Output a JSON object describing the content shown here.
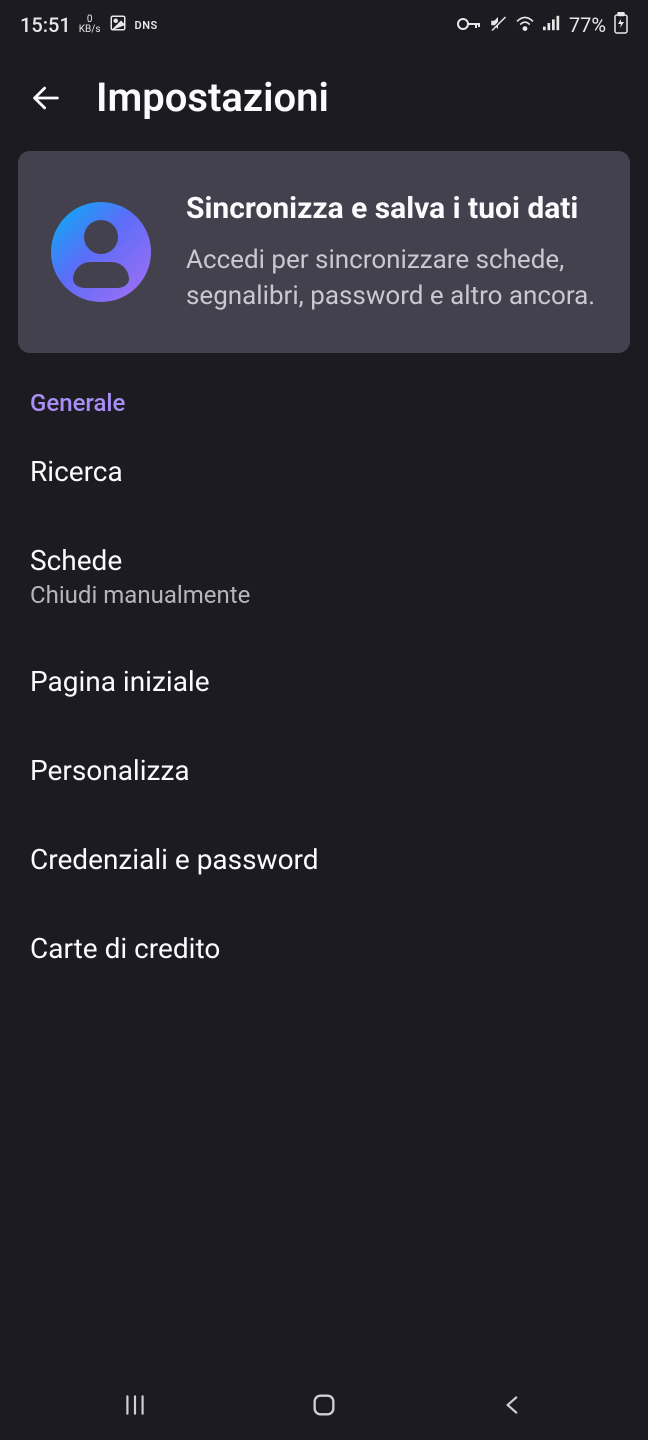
{
  "status": {
    "time": "15:51",
    "kbps_value": "0",
    "kbps_unit": "KB/s",
    "dns": "DNS",
    "battery": "77%"
  },
  "header": {
    "title": "Impostazioni"
  },
  "sync_card": {
    "title": "Sincronizza e salva i tuoi dati",
    "subtitle": "Accedi per sincronizzare schede, segnalibri, password e altro ancora."
  },
  "section": {
    "label": "Generale"
  },
  "items": [
    {
      "title": "Ricerca",
      "sub": ""
    },
    {
      "title": "Schede",
      "sub": "Chiudi manualmente"
    },
    {
      "title": "Pagina iniziale",
      "sub": ""
    },
    {
      "title": "Personalizza",
      "sub": ""
    },
    {
      "title": "Credenziali e password",
      "sub": ""
    },
    {
      "title": "Carte di credito",
      "sub": ""
    }
  ]
}
